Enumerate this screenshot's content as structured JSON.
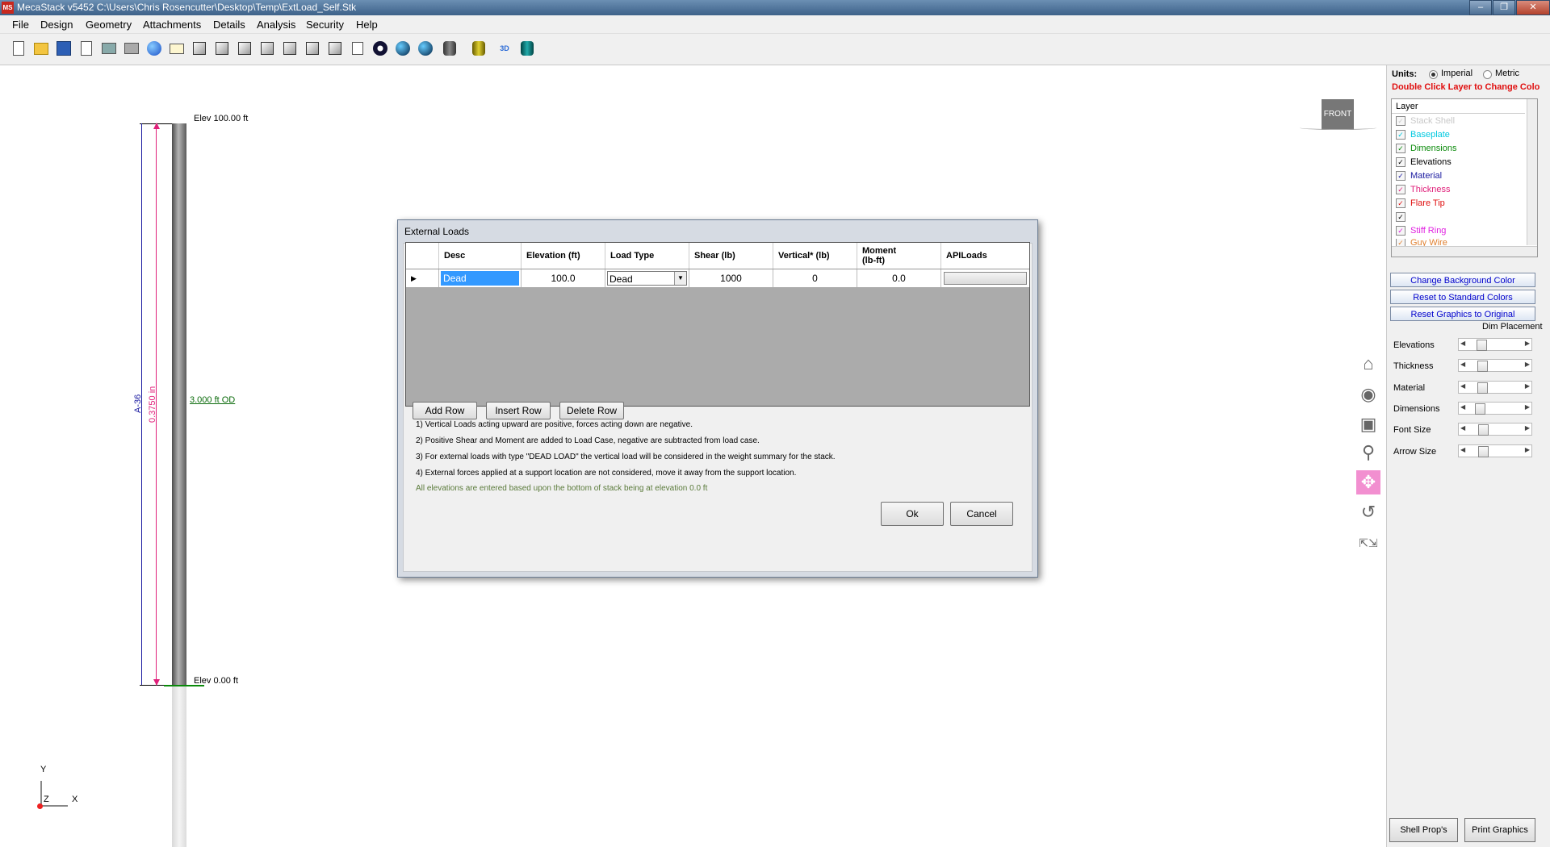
{
  "window": {
    "title": "MecaStack v5452 C:\\Users\\Chris Rosencutter\\Desktop\\Temp\\ExtLoad_Self.Stk",
    "icon_text": "MS"
  },
  "menu": [
    "File",
    "Design",
    "Geometry",
    "Attachments",
    "Details",
    "Analysis",
    "Security",
    "Help"
  ],
  "toolbar_icons": [
    "new-file-icon",
    "open-folder-icon",
    "save-icon",
    "print-preview-icon",
    "print-setup-icon",
    "printer-icon",
    "help-icon",
    "email-icon",
    "cube-view-1-icon",
    "cube-view-2-icon",
    "cube-view-3-icon",
    "cube-view-4-icon",
    "cube-view-5-icon",
    "cube-view-6-icon",
    "cube-view-7-icon",
    "report-icon",
    "camera-icon",
    "sphere-view-1-icon",
    "sphere-view-2-icon",
    "dark-barrel-icon",
    "yellow-barrel-icon",
    "3d-icon",
    "teal-barrel-icon"
  ],
  "drawing": {
    "elev_top": "Elev 100.00 ft",
    "elev_bottom": "Elev 0.00 ft",
    "od_label": "3.000 ft OD",
    "dim_blue": "A-36",
    "dim_pink": "0.3750 in",
    "view_cube": "FRONT",
    "axis_y": "Y",
    "axis_x": "X",
    "axis_z": "Z"
  },
  "dialog": {
    "title": "External Loads",
    "columns": [
      "Desc",
      "Elevation (ft)",
      "Load Type",
      "Shear (lb)",
      "Vertical* (lb)",
      "Moment\n(lb-ft)",
      "APILoads"
    ],
    "rows": [
      {
        "desc": "Dead",
        "elevation": "100.0",
        "load_type": "Dead",
        "shear": "1000",
        "vertical": "0",
        "moment": "0.0",
        "apiloads": ""
      }
    ],
    "buttons": {
      "add_row": "Add Row",
      "insert_row": "Insert Row",
      "delete_row": "Delete Row",
      "ok": "Ok",
      "cancel": "Cancel"
    },
    "notes": [
      "1) Vertical Loads acting upward are positive, forces acting down are negative.",
      "2) Positive Shear and Moment are added to Load Case, negative are subtracted from load case.",
      "3) For external loads with type \"DEAD LOAD\" the vertical load will be considered in the weight summary for the stack.",
      "4) External forces applied at a support location are not considered, move it away from the support location."
    ],
    "footnote": "All elevations are entered based upon the bottom of stack being at elevation 0.0 ft"
  },
  "right_panel": {
    "units_label": "Units:",
    "units_imperial": "Imperial",
    "units_metric": "Metric",
    "units_selected": "Imperial",
    "layer_hint": "Double Click Layer to Change Colo",
    "layer_header": "Layer",
    "layers": [
      {
        "name": "Stack Shell",
        "color": "#c8c8c8"
      },
      {
        "name": "Baseplate",
        "color": "#00c8e0"
      },
      {
        "name": "Dimensions",
        "color": "#0a8a0a"
      },
      {
        "name": "Elevations",
        "color": "#000000"
      },
      {
        "name": "Material",
        "color": "#1a1aa0"
      },
      {
        "name": "Thickness",
        "color": "#e0207a"
      },
      {
        "name": "Flare Tip",
        "color": "#e01010"
      },
      {
        "name": "",
        "color": "#000000"
      },
      {
        "name": "Stiff Ring",
        "color": "#e020e0"
      },
      {
        "name": "Guy Wire",
        "color": "#e08030"
      }
    ],
    "buttons": {
      "change_bg": "Change Background Color",
      "reset_colors": "Reset to Standard Colors",
      "reset_graphics": "Reset Graphics to Original"
    },
    "dim_placement_label": "Dim Placement",
    "sliders": [
      {
        "label": "Elevations",
        "value": 0.18
      },
      {
        "label": "Thickness",
        "value": 0.2
      },
      {
        "label": "Material",
        "value": 0.2
      },
      {
        "label": "Dimensions",
        "value": 0.15
      },
      {
        "label": "Font Size",
        "value": 0.22
      },
      {
        "label": "Arrow Size",
        "value": 0.22
      }
    ],
    "bottom_buttons": {
      "shell_props": "Shell Prop's",
      "print_graphics": "Print Graphics"
    }
  },
  "nav_icons": [
    "home-icon",
    "orbit-icon",
    "zoom-window-icon",
    "zoom-icon",
    "pan-icon",
    "rotate-icon",
    "fit-icon"
  ]
}
